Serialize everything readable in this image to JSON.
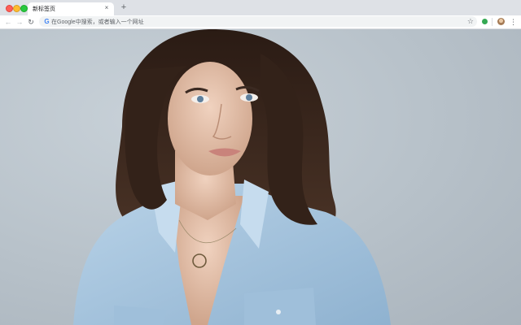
{
  "browser": {
    "tab": {
      "title": "新标签页",
      "close_glyph": "×"
    },
    "new_tab_glyph": "+",
    "nav": {
      "back_glyph": "←",
      "forward_glyph": "→",
      "reload_glyph": "↻"
    },
    "omnibox": {
      "engine_glyph": "G",
      "placeholder": "在Google中搜索，或者输入一个网址"
    },
    "bookmark_glyph": "☆",
    "menu_glyph": "⋮"
  },
  "icons": {
    "back": "arrow-left-icon",
    "forward": "arrow-right-icon",
    "reload": "reload-icon",
    "search_engine": "google-icon",
    "bookmark": "star-icon",
    "extension": "extension-icon",
    "profile": "avatar",
    "menu": "kebab-menu-icon"
  },
  "colors": {
    "tab_strip": "#dee1e6",
    "toolbar": "#ffffff",
    "omnibox": "#f1f3f4",
    "wallpaper_bg": "#b7c1c9",
    "hair": "#2b1d16",
    "skin": "#e4c2ad",
    "shirt": "#a9c7e0"
  }
}
